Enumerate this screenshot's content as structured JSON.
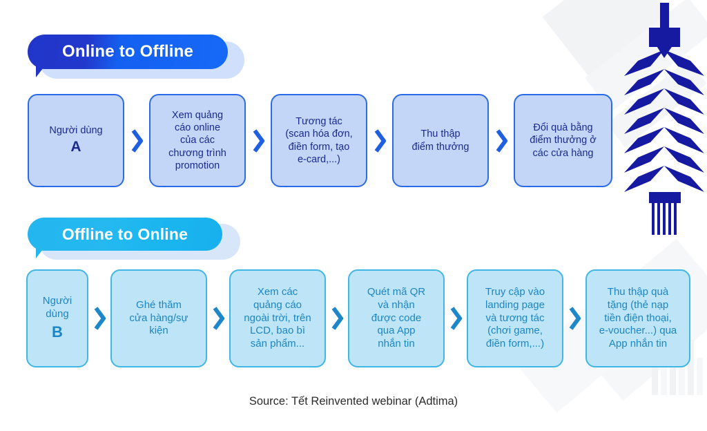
{
  "theme": {
    "row1_fill": "#c3d6f7",
    "row1_border": "#2a6ae8",
    "row1_text": "#1b2a8f",
    "row2_fill": "#bee5f7",
    "row2_border": "#3fb6e6",
    "row2_text": "#1c85c4",
    "badge1_color": "#1b4fe0",
    "badge2_color": "#22b6ef",
    "ornament_color": "#151aa0",
    "page_background": "#ffffff"
  },
  "sections": [
    {
      "id": "online-to-offline",
      "badge_label": "Online to Offline",
      "steps": [
        {
          "text": "Người dùng",
          "emphasis": "A"
        },
        {
          "text": "Xem quảng\ncáo online\ncủa các\nchương trình\npromotion",
          "emphasis": ""
        },
        {
          "text": "Tương tác\n(scan hóa đơn,\nđiền form, tạo\ne-card,...)",
          "emphasis": ""
        },
        {
          "text": "Thu thập\nđiểm thưởng",
          "emphasis": ""
        },
        {
          "text": "Đổi quà bằng\nđiểm thưởng ở\ncác cửa hàng",
          "emphasis": ""
        }
      ],
      "connector_icon": "chevron-right-icon"
    },
    {
      "id": "offline-to-online",
      "badge_label": "Offline to Online",
      "steps": [
        {
          "text": "Người\ndùng",
          "emphasis": "B"
        },
        {
          "text": "Ghé thăm\ncửa hàng/sự\nkiện",
          "emphasis": ""
        },
        {
          "text": "Xem các\nquảng cáo\nngoài trời, trên\nLCD, bao bì\nsản phẩm...",
          "emphasis": ""
        },
        {
          "text": "Quét mã QR\nvà nhận\nđược code\nqua App\nnhắn tin",
          "emphasis": ""
        },
        {
          "text": "Truy cập vào\nlanding page\nvà tương tác\n(chơi game,\nđiền form,...)",
          "emphasis": ""
        },
        {
          "text": "Thu thập quà\ntặng (thẻ nạp\ntiền điện thoại,\ne-voucher...) qua\nApp nhắn tin",
          "emphasis": ""
        }
      ],
      "connector_icon": "chevron-right-icon"
    }
  ],
  "caption": {
    "source": "Source: Tết Reinvented webinar (Adtima)"
  },
  "decoration": {
    "ornament_name": "firecracker-ornament"
  }
}
